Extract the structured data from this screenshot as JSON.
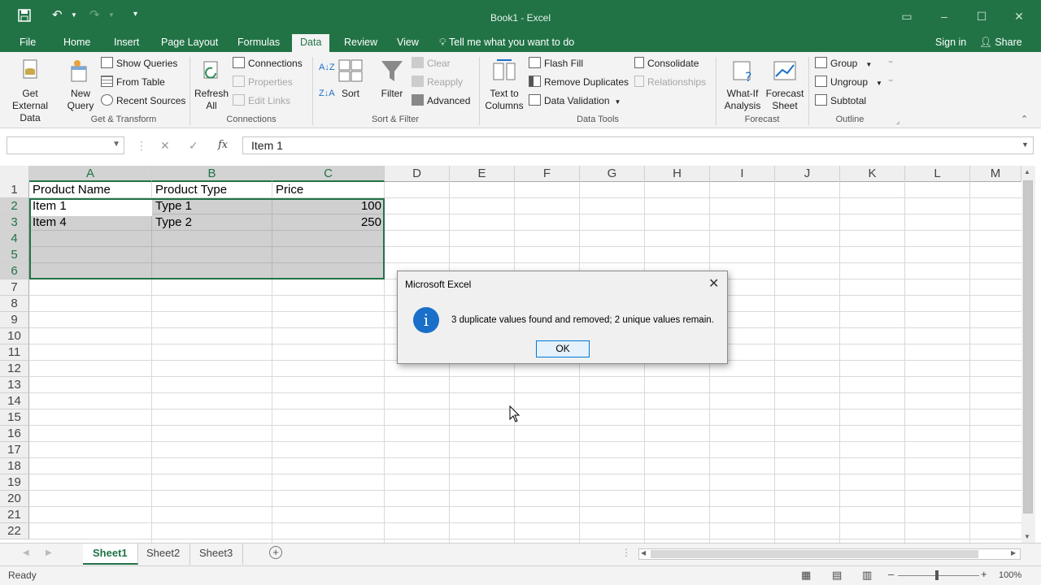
{
  "window": {
    "title": "Book1 - Excel"
  },
  "tabs": [
    {
      "label": "File"
    },
    {
      "label": "Home"
    },
    {
      "label": "Insert"
    },
    {
      "label": "Page Layout"
    },
    {
      "label": "Formulas"
    },
    {
      "label": "Data"
    },
    {
      "label": "Review"
    },
    {
      "label": "View"
    }
  ],
  "tell_me": "Tell me what you want to do",
  "account": {
    "sign_in": "Sign in",
    "share": "Share"
  },
  "ribbon": {
    "get_transform": {
      "label": "Get & Transform",
      "get_external_data": "Get External Data",
      "new_query": "New Query",
      "show_queries": "Show Queries",
      "from_table": "From Table",
      "recent_sources": "Recent Sources"
    },
    "connections": {
      "label": "Connections",
      "refresh_all": "Refresh All",
      "connections": "Connections",
      "properties": "Properties",
      "edit_links": "Edit Links"
    },
    "sort_filter": {
      "label": "Sort & Filter",
      "sort": "Sort",
      "filter": "Filter",
      "clear": "Clear",
      "reapply": "Reapply",
      "advanced": "Advanced"
    },
    "data_tools": {
      "label": "Data Tools",
      "text_to_columns": "Text to Columns",
      "flash_fill": "Flash Fill",
      "remove_duplicates": "Remove Duplicates",
      "data_validation": "Data Validation",
      "consolidate": "Consolidate",
      "relationships": "Relationships"
    },
    "forecast": {
      "label": "Forecast",
      "what_if": "What-If Analysis",
      "forecast_sheet": "Forecast Sheet"
    },
    "outline": {
      "label": "Outline",
      "group": "Group",
      "ungroup": "Ungroup",
      "subtotal": "Subtotal"
    }
  },
  "formula_bar": {
    "name_box": "",
    "value": "Item 1"
  },
  "columns": [
    "A",
    "B",
    "C",
    "D",
    "E",
    "F",
    "G",
    "H",
    "I",
    "J",
    "K",
    "L",
    "M"
  ],
  "rows": [
    "1",
    "2",
    "3",
    "4",
    "5",
    "6",
    "7",
    "8",
    "9",
    "10",
    "11",
    "12",
    "13",
    "14",
    "15",
    "16",
    "17",
    "18",
    "19",
    "20",
    "21",
    "22"
  ],
  "cells": {
    "r1": [
      "Product Name",
      "Product Type",
      "Price"
    ],
    "r2": [
      "Item 1",
      "Type 1",
      "100"
    ],
    "r3": [
      "Item 4",
      "Type 2",
      "250"
    ]
  },
  "sheets": [
    "Sheet1",
    "Sheet2",
    "Sheet3"
  ],
  "status": {
    "text": "Ready",
    "zoom": "100%"
  },
  "dialog": {
    "title": "Microsoft Excel",
    "message": "3 duplicate values found and removed; 2 unique values remain.",
    "ok": "OK"
  },
  "colors": {
    "accent": "#217346",
    "info": "#1a6fc8"
  }
}
